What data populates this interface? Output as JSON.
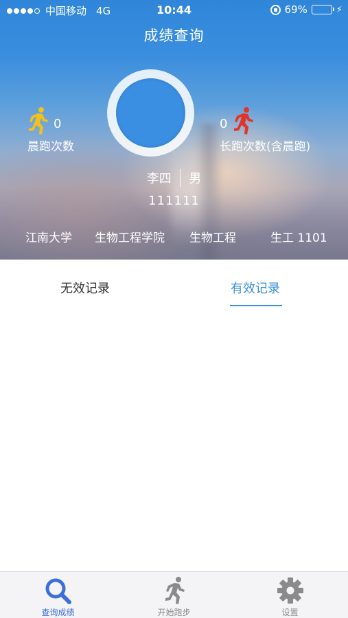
{
  "status_bar": {
    "carrier": "中国移动",
    "network": "4G",
    "time": "10:44",
    "battery": "69%",
    "battery_level": 0.69
  },
  "header": {
    "title": "成绩查询"
  },
  "stats": {
    "morning_run": {
      "count": "0",
      "label": "晨跑次数",
      "icon": "runner-yellow-icon"
    },
    "long_run": {
      "count": "0",
      "label": "长跑次数(含晨跑)",
      "icon": "runner-red-icon"
    }
  },
  "profile": {
    "name": "李四",
    "gender": "男",
    "student_id": "111111",
    "university": "江南大学",
    "college": "生物工程学院",
    "major": "生物工程",
    "class": "生工 1101"
  },
  "tabs": [
    {
      "label": "无效记录",
      "active": false
    },
    {
      "label": "有效记录",
      "active": true
    }
  ],
  "bottom_nav": [
    {
      "label": "查询成绩",
      "icon": "search-icon",
      "active": true
    },
    {
      "label": "开始跑步",
      "icon": "runner-icon",
      "active": false
    },
    {
      "label": "设置",
      "icon": "gear-icon",
      "active": false
    }
  ],
  "colors": {
    "accent": "#3a8fd6",
    "nav_active": "#3d6fd8",
    "morning_runner": "#f2c11a",
    "long_runner": "#e2352a",
    "battery": "#4cd964"
  }
}
